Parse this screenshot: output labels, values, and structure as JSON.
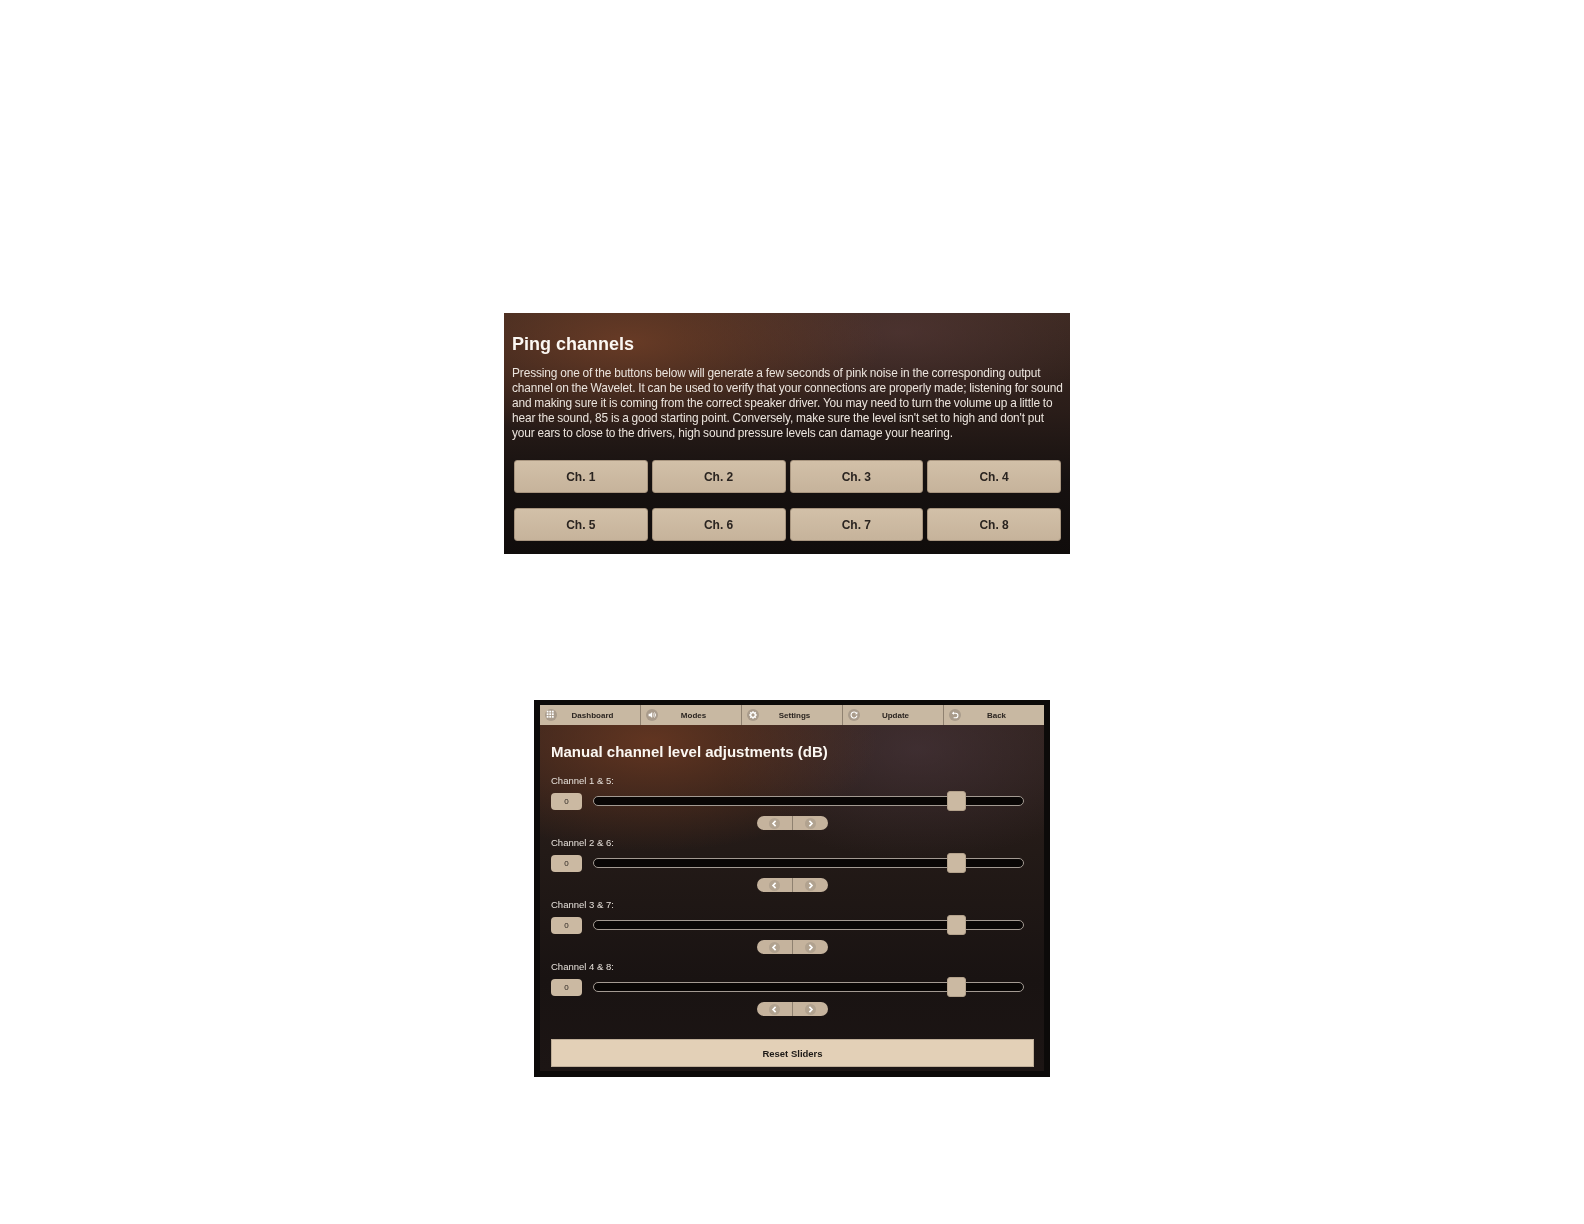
{
  "ping_panel": {
    "title": "Ping channels",
    "description": "Pressing one of the buttons below will generate a few seconds of pink noise in the corresponding output channel on the Wavelet. It can be used to verify that your connections are properly made; listening for sound and making sure it is coming from the correct speaker driver. You may need to turn the volume up a little to hear the sound, 85 is a good starting point. Conversely, make sure the level isn't set to high and don't put your ears to close to the drivers, high sound pressure levels can damage your hearing.",
    "buttons": [
      "Ch. 1",
      "Ch. 2",
      "Ch. 3",
      "Ch. 4",
      "Ch. 5",
      "Ch. 6",
      "Ch. 7",
      "Ch. 8"
    ]
  },
  "levels_panel": {
    "nav": [
      "Dashboard",
      "Modes",
      "Settings",
      "Update",
      "Back"
    ],
    "title": "Manual channel level adjustments (dB)",
    "channels": [
      {
        "label": "Channel 1 & 5:",
        "value": "0",
        "level": 0.86
      },
      {
        "label": "Channel 2 & 6:",
        "value": "0",
        "level": 0.86
      },
      {
        "label": "Channel 3 & 7:",
        "value": "0",
        "level": 0.86
      },
      {
        "label": "Channel 4 & 8:",
        "value": "0",
        "level": 0.86
      }
    ],
    "reset_button": "Reset Sliders"
  }
}
